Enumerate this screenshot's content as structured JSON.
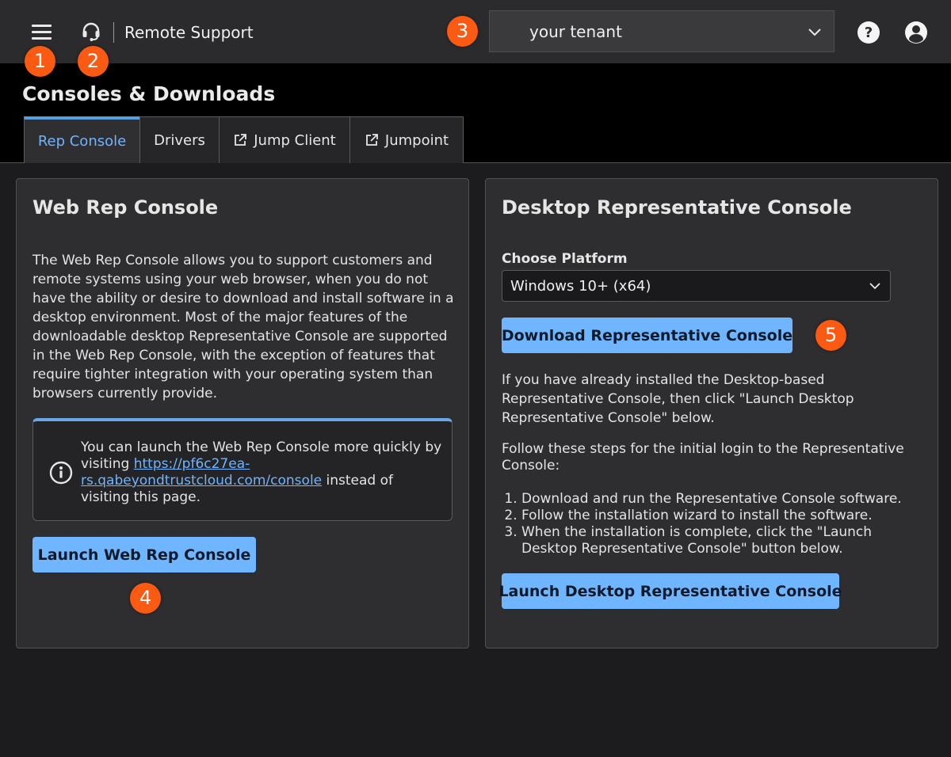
{
  "topbar": {
    "brand": "Remote Support",
    "icons": [
      "menu-icon",
      "headset-icon",
      "help-icon",
      "user-icon",
      "chevron-down-icon"
    ],
    "tenant": {
      "selected": "your tenant"
    }
  },
  "badges": [
    "1",
    "2",
    "3",
    "4",
    "5"
  ],
  "page": {
    "title": "Consoles & Downloads",
    "tabs": [
      {
        "label": "Rep Console",
        "active": true
      },
      {
        "label": "Drivers",
        "active": false
      },
      {
        "label": "Jump Client",
        "active": false,
        "icon": "external-link-icon"
      },
      {
        "label": "Jumpoint",
        "active": false,
        "icon": "external-link-icon"
      }
    ]
  },
  "web_console": {
    "title": "Web Rep Console",
    "description": "The Web Rep Console allows you to support customers and remote systems using your web browser, when you do not have the ability or desire to download and install software in a desktop environment. Most of the major features of the downloadable desktop Representative Console are supported in the Web Rep Console, with the exception of features that require tighter integration with your operating system than browsers currently provide.",
    "info": {
      "text_before": "You can launch the Web Rep Console more quickly by visiting ",
      "link": "https://pf6c27ea-rs.qabeyondtrustcloud.com/console",
      "text_after": " instead of visiting this page."
    },
    "launch_button": "Launch Web Rep Console"
  },
  "desktop_console": {
    "title": "Desktop Representative Console",
    "platform_label": "Choose Platform",
    "platform_selected": "Windows 10+ (x64)",
    "download_button": "Download Representative Console",
    "installed_text": "If you have already installed the Desktop-based Representative Console, then click \"Launch Desktop Representative Console\" below.",
    "steps_intro": "Follow these steps for the initial login to the Representative Console:",
    "steps": [
      "Download and run the Representative Console software.",
      "Follow the installation wizard to install the software.",
      "When the installation is complete, click the \"Launch Desktop Representative Console\" button below."
    ],
    "launch_button": "Launch Desktop Representative Console"
  },
  "colors": {
    "accent": "#70b5ff",
    "badge": "#fa5a11",
    "topbar": "#2b2b2d",
    "background": "#1c1c1e"
  }
}
